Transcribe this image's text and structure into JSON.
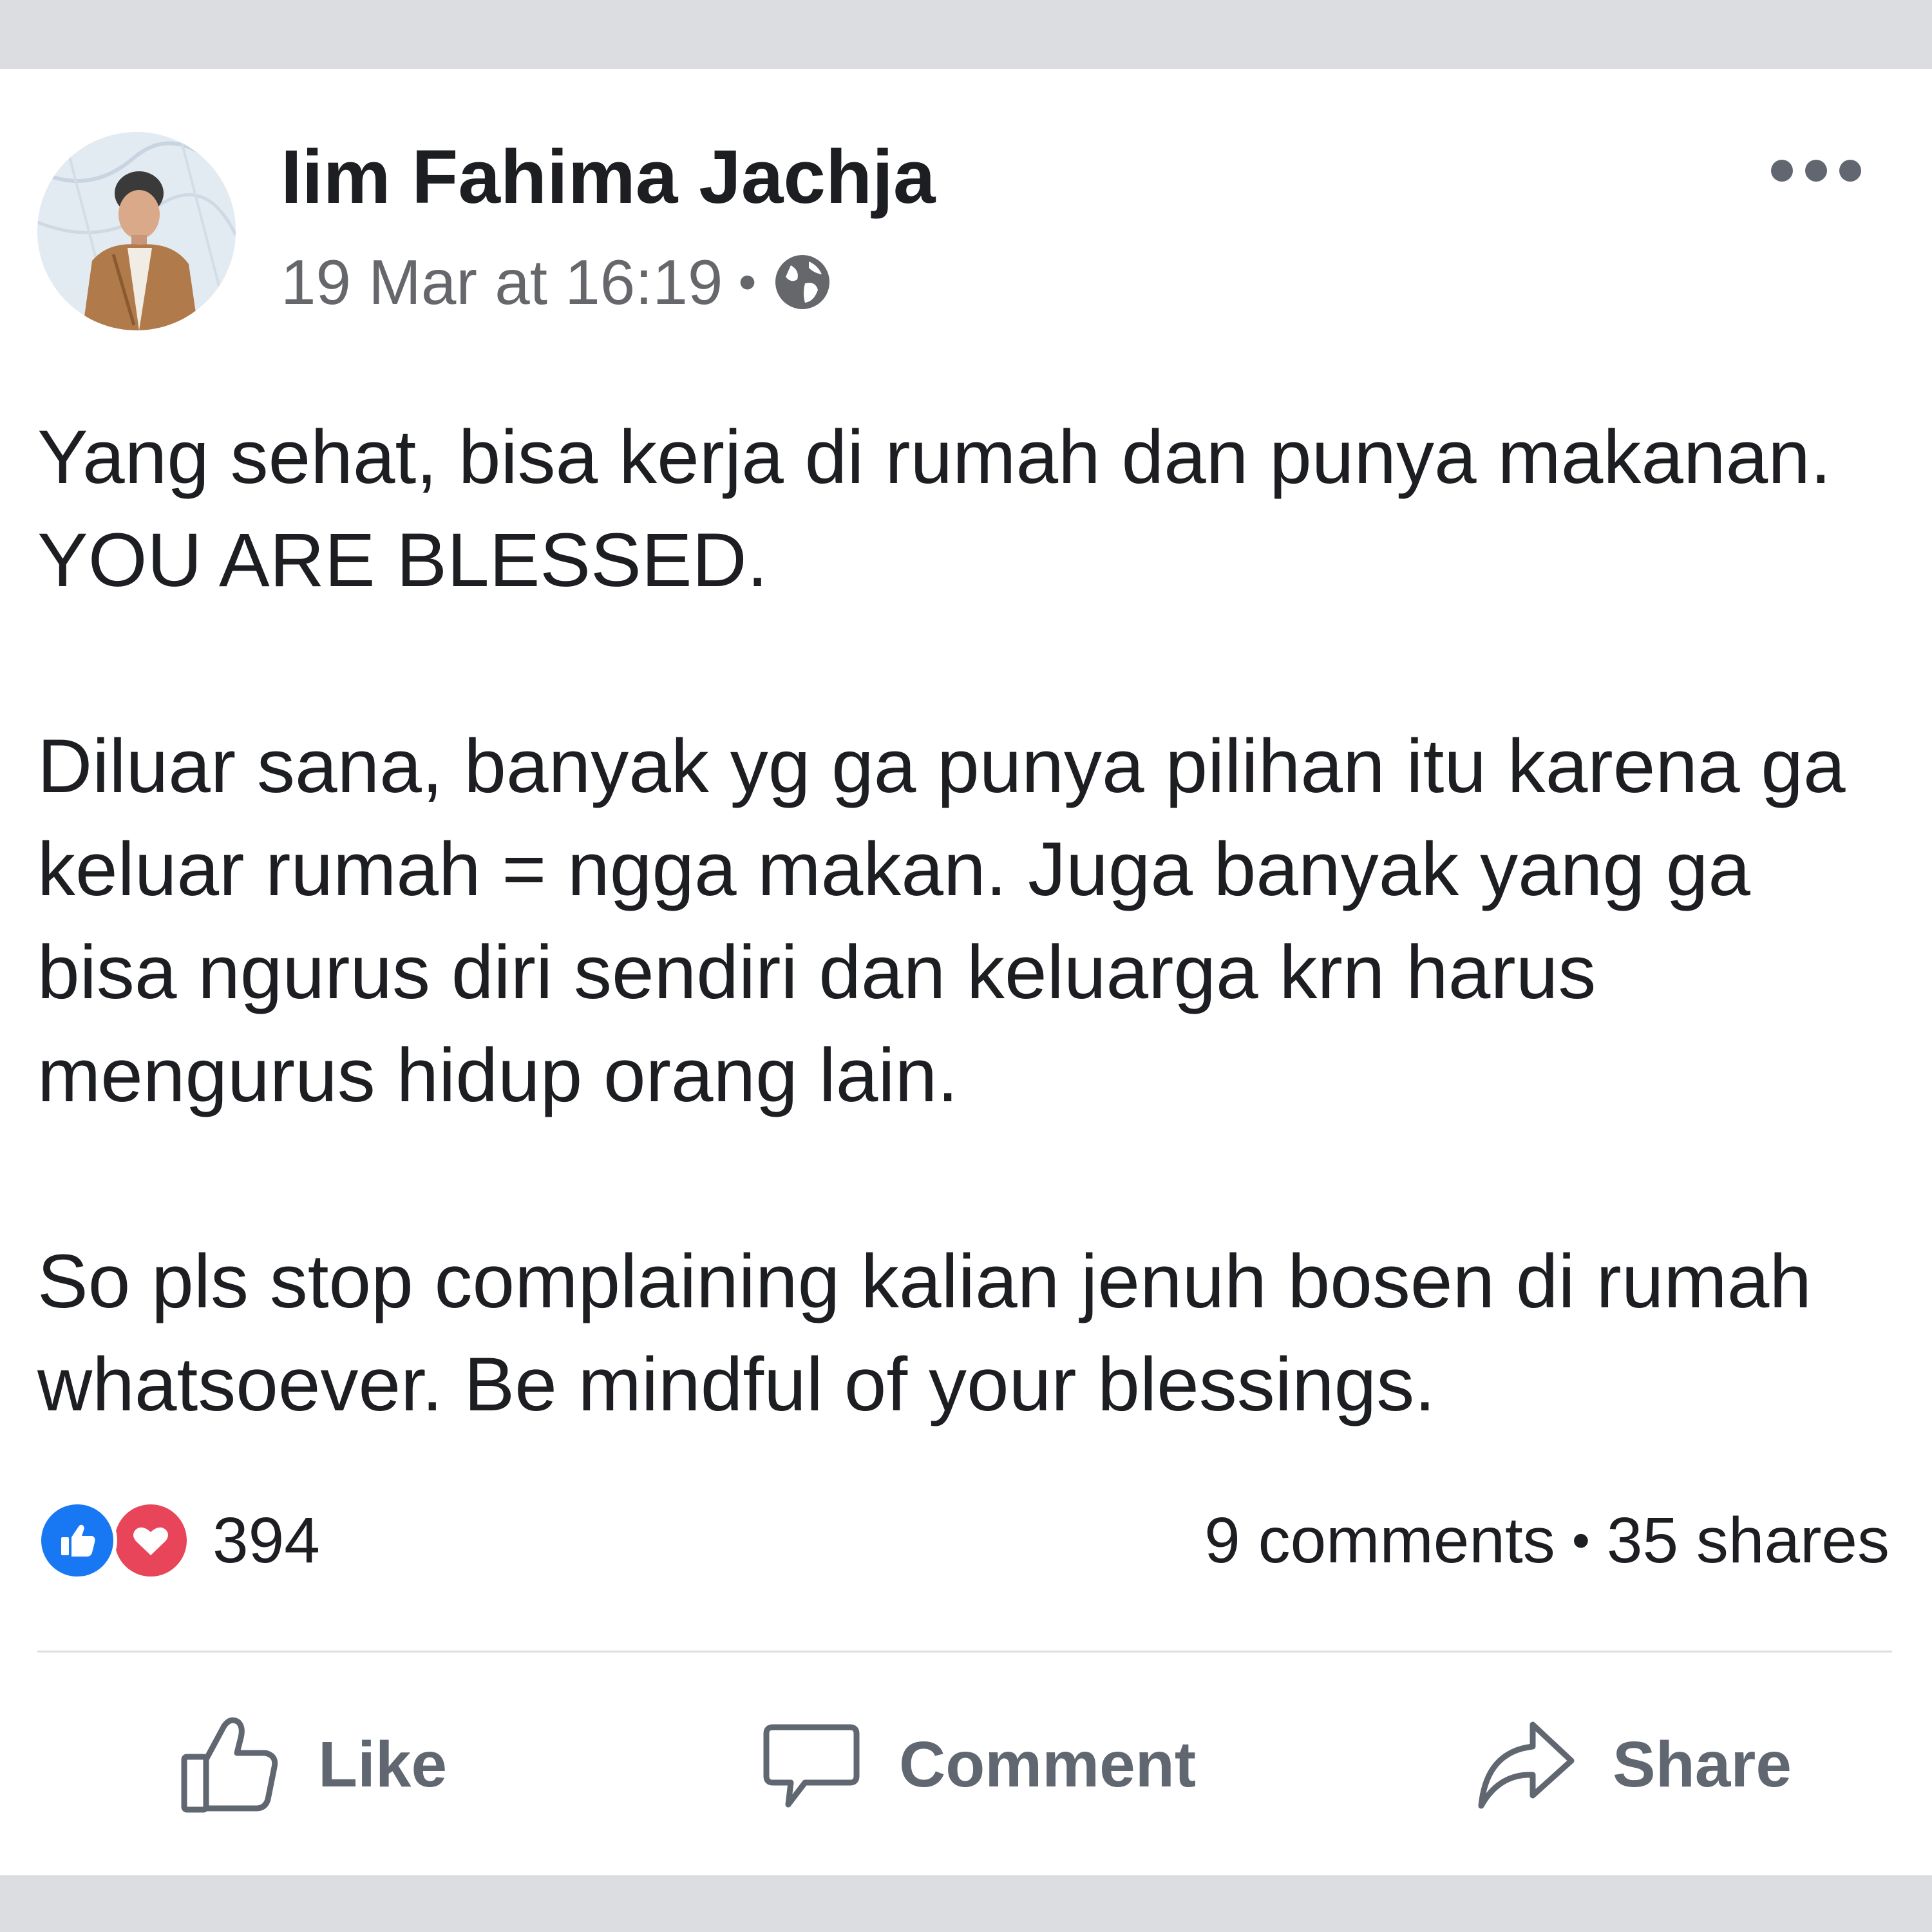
{
  "post": {
    "author": "Iim Fahima Jachja",
    "timestamp": "19 Mar at 16:19",
    "separator": "•",
    "privacy_icon": "globe-icon",
    "more_icon": "more-options-icon",
    "avatar": "avatar",
    "paragraphs": [
      "Yang sehat, bisa kerja di rumah dan punya makanan. YOU ARE BLESSED.",
      "Diluar sana, banyak yg ga punya pilihan itu karena ga keluar rumah = ngga makan. Juga banyak yang ga bisa ngurus diri sendiri dan keluarga krn harus mengurus hidup orang lain.",
      "So pls stop complaining kalian jenuh bosen di rumah whatsoever. Be mindful of your blessings."
    ]
  },
  "reactions": {
    "count": "394",
    "types": [
      "like",
      "love"
    ],
    "like_color": "#1877f2",
    "love_color": "#e8455a"
  },
  "stats": {
    "comments": "9 comments",
    "separator": "•",
    "shares": "35 shares"
  },
  "actions": {
    "like_label": "Like",
    "comment_label": "Comment",
    "share_label": "Share"
  },
  "colors": {
    "text": "#1c1e21",
    "muted": "#65676b",
    "background": "#dcdde1"
  }
}
